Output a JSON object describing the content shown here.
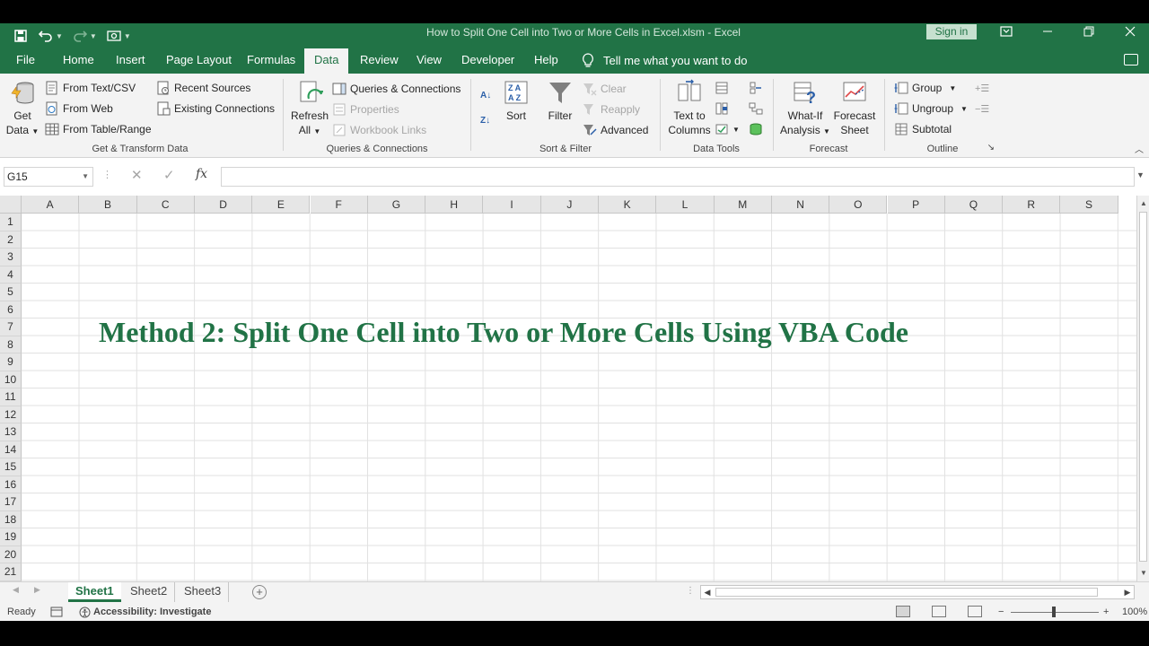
{
  "titlebar": {
    "title": "How to Split One Cell into Two or More Cells in Excel.xlsm  -  Excel",
    "signin": "Sign in",
    "colors": {
      "brand": "#217346"
    }
  },
  "tabs": [
    "File",
    "Home",
    "Insert",
    "Page Layout",
    "Formulas",
    "Data",
    "Review",
    "View",
    "Developer",
    "Help"
  ],
  "active_tab": "Data",
  "tellme": "Tell me what you want to do",
  "ribbon": {
    "get_transform": {
      "get_data_l1": "Get",
      "get_data_l2": "Data",
      "from_text_csv": "From Text/CSV",
      "from_web": "From Web",
      "from_table_range": "From Table/Range",
      "recent_sources": "Recent Sources",
      "existing_connections": "Existing Connections",
      "label": "Get & Transform Data"
    },
    "queries": {
      "refresh_l1": "Refresh",
      "refresh_l2": "All",
      "queries_connections": "Queries & Connections",
      "properties": "Properties",
      "workbook_links": "Workbook Links",
      "label": "Queries & Connections"
    },
    "sort_filter": {
      "sort": "Sort",
      "filter": "Filter",
      "clear": "Clear",
      "reapply": "Reapply",
      "advanced": "Advanced",
      "label": "Sort & Filter"
    },
    "data_tools": {
      "text_to_columns_l1": "Text to",
      "text_to_columns_l2": "Columns",
      "label": "Data Tools"
    },
    "forecast": {
      "what_if_l1": "What-If",
      "what_if_l2": "Analysis",
      "forecast_sheet_l1": "Forecast",
      "forecast_sheet_l2": "Sheet",
      "label": "Forecast"
    },
    "outline": {
      "group": "Group",
      "ungroup": "Ungroup",
      "subtotal": "Subtotal",
      "label": "Outline"
    }
  },
  "formula_bar": {
    "name_box": "G15",
    "fx": "fx",
    "formula": ""
  },
  "grid": {
    "columns": [
      "A",
      "B",
      "C",
      "D",
      "E",
      "F",
      "G",
      "H",
      "I",
      "J",
      "K",
      "L",
      "M",
      "N",
      "O",
      "P",
      "Q",
      "R",
      "S"
    ],
    "rows": [
      "1",
      "2",
      "3",
      "4",
      "5",
      "6",
      "7",
      "8",
      "9",
      "10",
      "11",
      "12",
      "13",
      "14",
      "15",
      "16",
      "17",
      "18",
      "19",
      "20",
      "21"
    ]
  },
  "overlay_title": "Method 2: Split One Cell into Two or More Cells Using VBA Code",
  "sheets": [
    "Sheet1",
    "Sheet2",
    "Sheet3"
  ],
  "active_sheet": "Sheet1",
  "status": {
    "ready": "Ready",
    "accessibility": "Accessibility: Investigate",
    "zoom_minus": "−",
    "zoom_plus": "+",
    "zoom": "100%"
  }
}
